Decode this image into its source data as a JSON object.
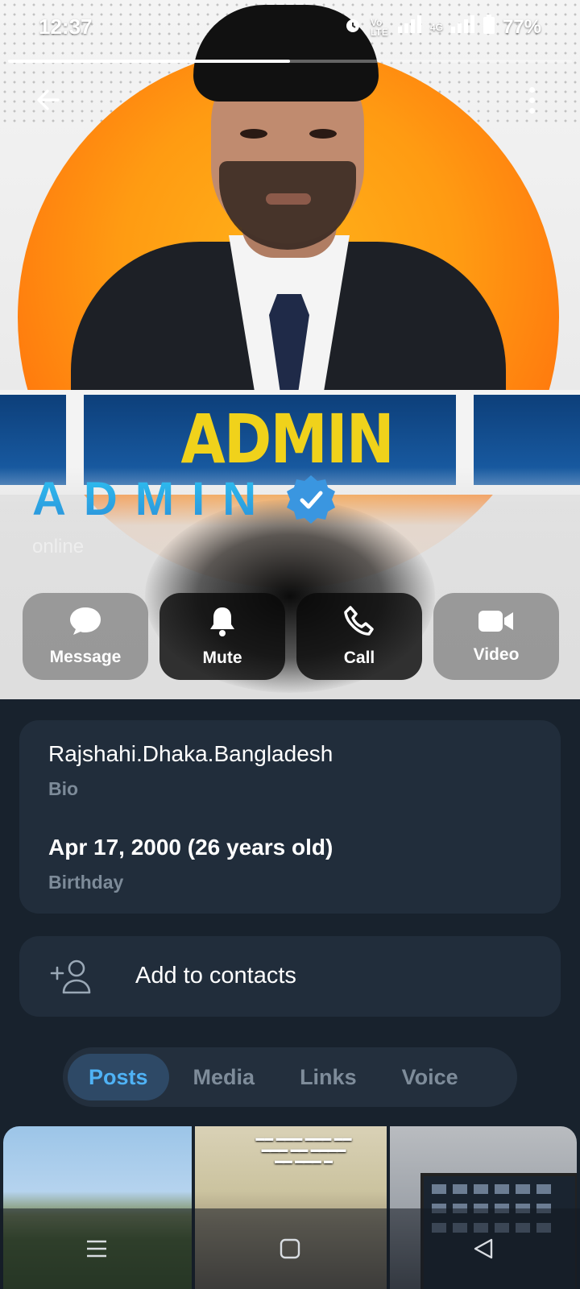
{
  "status_bar": {
    "time": "12:37",
    "volte": "Vo LTE",
    "network": "4G",
    "battery": "77%",
    "story_progress": 0.5
  },
  "profile": {
    "banner_text": "ADMIN",
    "name": "ADMIN",
    "presence": "online",
    "verified_icon": "verified-badge-icon"
  },
  "actions": [
    {
      "label": "Message",
      "icon": "message-icon"
    },
    {
      "label": "Mute",
      "icon": "bell-icon"
    },
    {
      "label": "Call",
      "icon": "phone-icon"
    },
    {
      "label": "Video",
      "icon": "video-icon"
    }
  ],
  "info": {
    "bio_value": "Rajshahi.Dhaka.Bangladesh",
    "bio_label": "Bio",
    "birthday_value": "Apr 17, 2000 (26 years old)",
    "birthday_label": "Birthday"
  },
  "contacts": {
    "label": "Add to contacts",
    "icon": "add-person-icon"
  },
  "tabs": [
    {
      "label": "Posts",
      "active": true
    },
    {
      "label": "Media",
      "active": false
    },
    {
      "label": "Links",
      "active": false
    },
    {
      "label": "Voice",
      "active": false
    }
  ],
  "colors": {
    "background": "#18222d",
    "card": "#212d3b",
    "accent": "#4fb2f5",
    "muted_text": "#7d8b99"
  }
}
